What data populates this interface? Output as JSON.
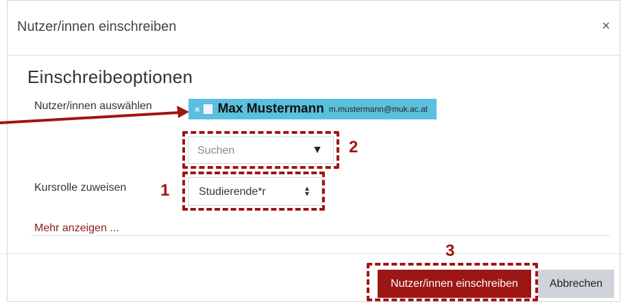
{
  "modal": {
    "title": "Nutzer/innen einschreiben",
    "close_icon": "close-icon"
  },
  "section": {
    "title": "Einschreibeoptionen"
  },
  "user_select": {
    "label": "Nutzer/innen auswählen",
    "remove_glyph": "×",
    "selected_user": {
      "name": "Max Mustermann",
      "email": "m.mustermann@muk.ac.at"
    },
    "search_placeholder": "Suchen",
    "dropdown_icon": "triangle-down-icon"
  },
  "role": {
    "label": "Kursrolle zuweisen",
    "selected": "Studierende*r",
    "dropdown_icon": "updown-icon"
  },
  "more_link": "Mehr anzeigen ...",
  "buttons": {
    "enrol": "Nutzer/innen einschreiben",
    "cancel": "Abbrechen"
  },
  "annotations": {
    "marker_1": "1",
    "marker_2": "2",
    "marker_3": "3",
    "color": "#a11414"
  },
  "colors": {
    "chip_bg": "#5bc0de",
    "primary": "#9c1616",
    "secondary": "#ced4da",
    "link": "#8b1a1a"
  }
}
